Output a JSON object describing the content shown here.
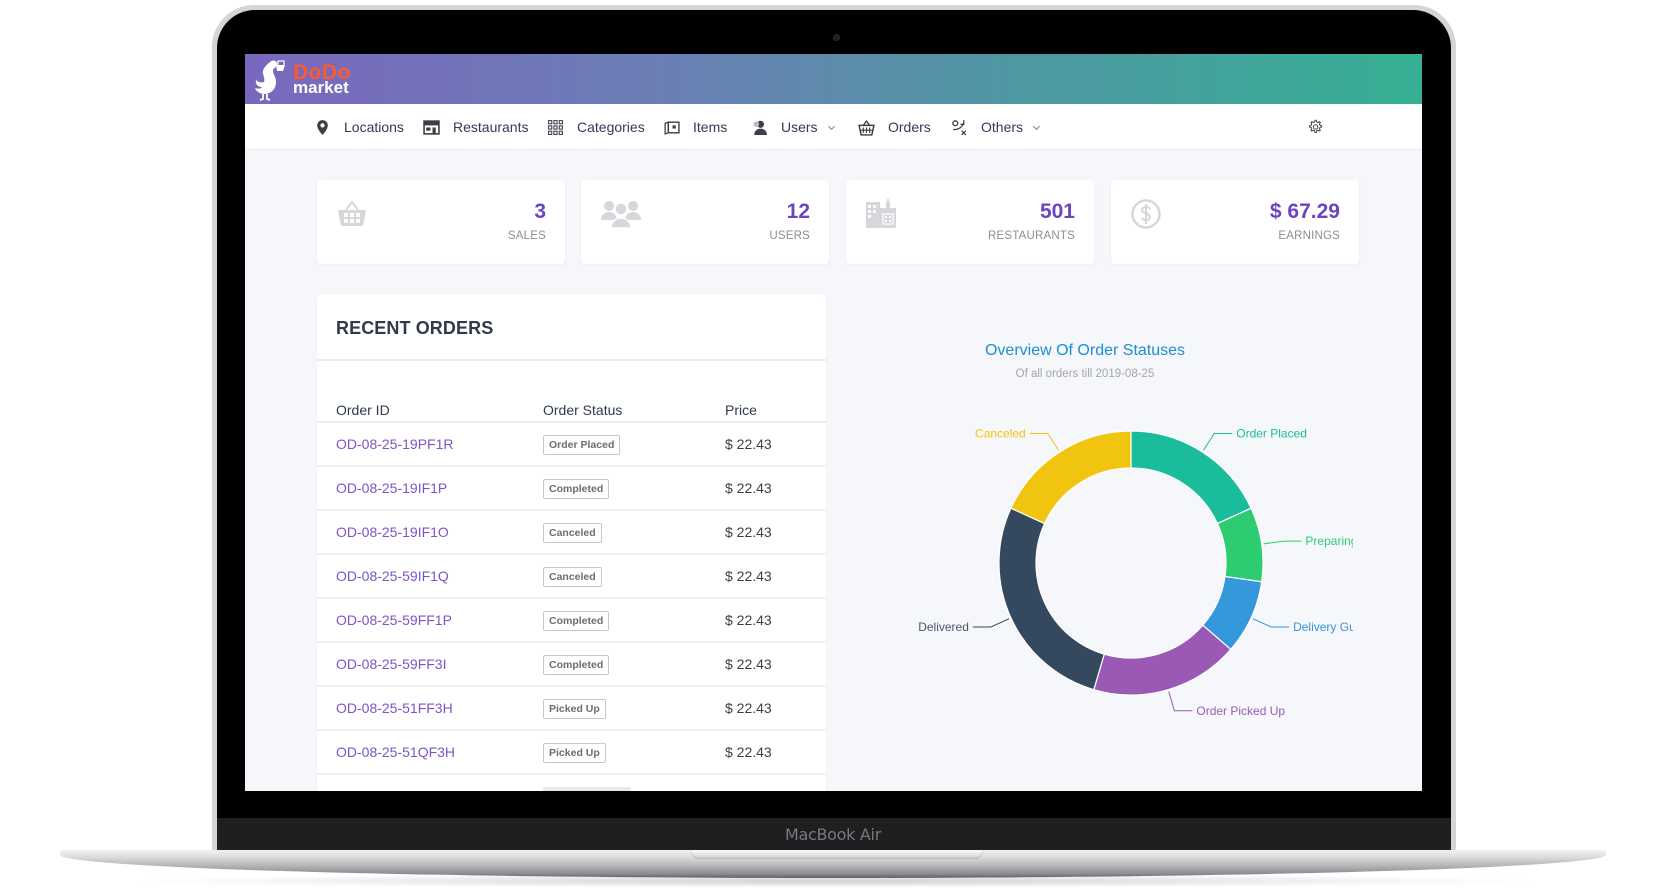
{
  "device": {
    "label": "MacBook Air"
  },
  "brand": {
    "line1": "DoDo",
    "line2": "market",
    "accent": "#ff5a2c"
  },
  "nav": {
    "items": [
      {
        "label": "Locations",
        "icon": "map-pin-icon"
      },
      {
        "label": "Restaurants",
        "icon": "storefront-icon"
      },
      {
        "label": "Categories",
        "icon": "grid-icon"
      },
      {
        "label": "Items",
        "icon": "item-card-icon"
      },
      {
        "label": "Users",
        "icon": "user-icon",
        "dropdown": true
      },
      {
        "label": "Orders",
        "icon": "basket-icon"
      },
      {
        "label": "Others",
        "icon": "route-icon",
        "dropdown": true
      }
    ],
    "settings_icon": "gear-icon"
  },
  "stats": [
    {
      "value": "3",
      "label": "SALES",
      "icon": "basket-icon"
    },
    {
      "value": "12",
      "label": "USERS",
      "icon": "users-group-icon"
    },
    {
      "value": "501",
      "label": "RESTAURANTS",
      "icon": "buildings-icon"
    },
    {
      "value": "$ 67.29",
      "label": "EARNINGS",
      "icon": "dollar-coin-icon"
    }
  ],
  "recent_orders": {
    "title": "RECENT ORDERS",
    "columns": [
      "Order ID",
      "Order Status",
      "Price"
    ],
    "rows": [
      {
        "id": "OD-08-25-19PF1R",
        "status": "Order Placed",
        "price": "$ 22.43"
      },
      {
        "id": "OD-08-25-19IF1P",
        "status": "Completed",
        "price": "$ 22.43"
      },
      {
        "id": "OD-08-25-19IF1O",
        "status": "Canceled",
        "price": "$ 22.43"
      },
      {
        "id": "OD-08-25-59IF1Q",
        "status": "Canceled",
        "price": "$ 22.43"
      },
      {
        "id": "OD-08-25-59FF1P",
        "status": "Completed",
        "price": "$ 22.43"
      },
      {
        "id": "OD-08-25-59FF3I",
        "status": "Completed",
        "price": "$ 22.43"
      },
      {
        "id": "OD-08-25-51FF3H",
        "status": "Picked Up",
        "price": "$ 22.43"
      },
      {
        "id": "OD-08-25-51QF3H",
        "status": "Picked Up",
        "price": "$ 22.43"
      }
    ]
  },
  "chart_data": {
    "type": "pie",
    "variant": "donut",
    "title": "Overview Of Order Statuses",
    "subtitle": "Of all orders till 2019-08-25",
    "categories": [
      "Order Placed",
      "Preparing O",
      "Delivery Guy .",
      "Order Picked Up",
      "Delivered",
      "Canceled"
    ],
    "values": [
      2,
      1,
      1,
      2,
      3,
      2
    ],
    "colors": [
      "#1abc9c",
      "#2ecc71",
      "#3498db",
      "#9b59b6",
      "#34495e",
      "#f1c40f"
    ],
    "legend": "none",
    "labels": "outside-with-leader-lines"
  }
}
